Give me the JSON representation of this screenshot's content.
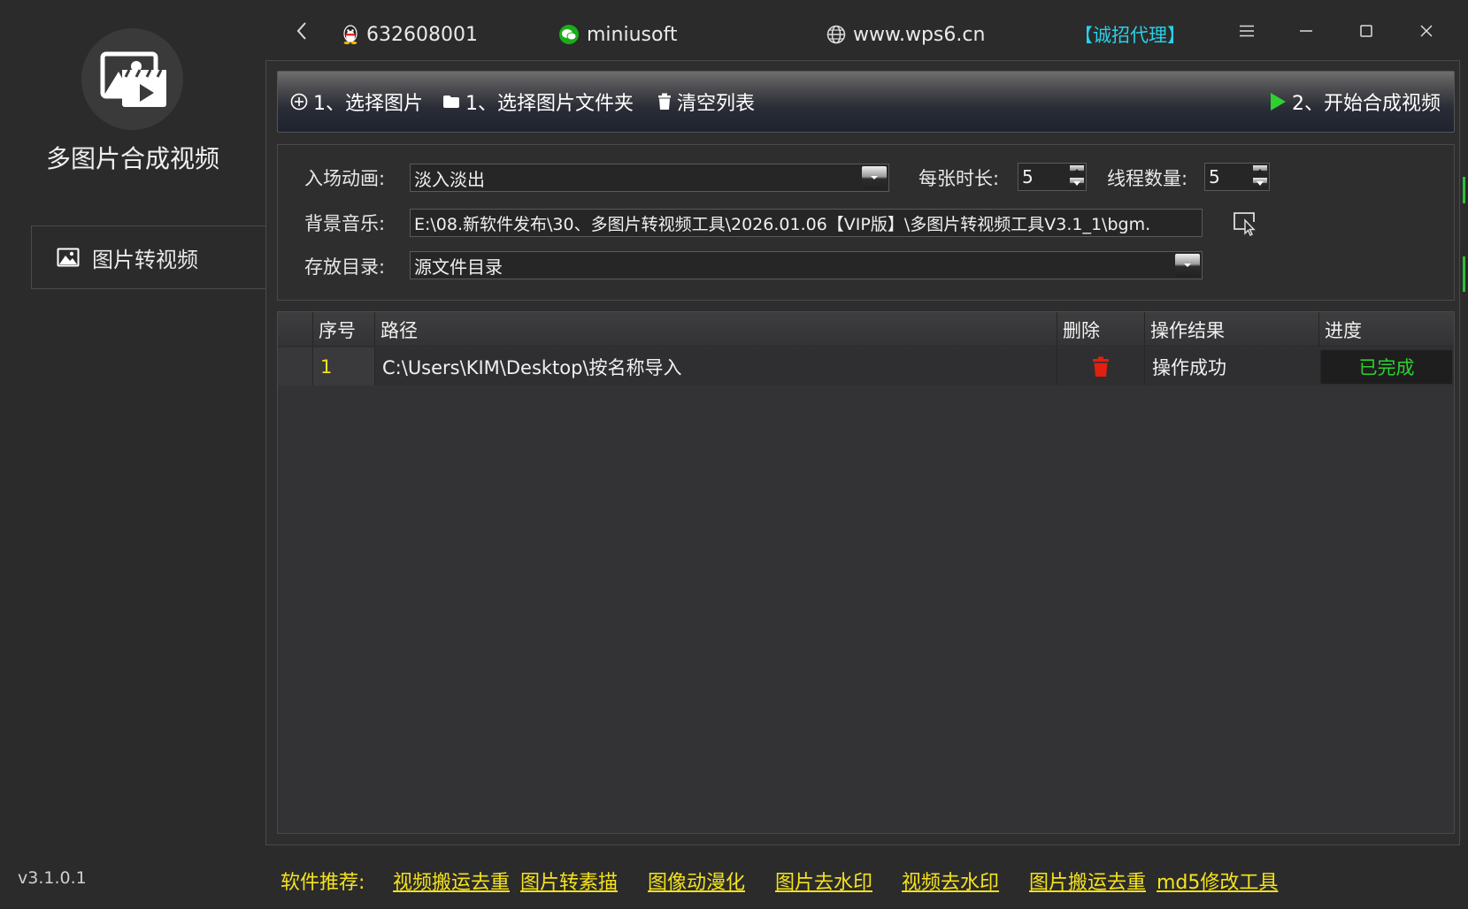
{
  "app": {
    "title": "多图片合成视频",
    "version": "v3.1.0.1"
  },
  "sidebar": {
    "items": [
      {
        "label": "图片转视频",
        "icon": "image-icon"
      }
    ]
  },
  "titlebar": {
    "qq": "632608001",
    "wechat": "miniusoft",
    "website": "www.wps6.cn",
    "agent": "【诚招代理】"
  },
  "toolbar": {
    "select_images": "1、选择图片",
    "select_folder": "1、选择图片文件夹",
    "clear_list": "清空列表",
    "start": "2、开始合成视频"
  },
  "settings": {
    "transition_label": "入场动画:",
    "transition_value": "淡入淡出",
    "duration_label": "每张时长:",
    "duration_value": "5",
    "threads_label": "线程数量:",
    "threads_value": "5",
    "bgm_label": "背景音乐:",
    "bgm_value": "E:\\08.新软件发布\\30、多图片转视频工具\\2026.01.06【VIP版】\\多图片转视频工具V3.1_1\\bgm.",
    "output_label": "存放目录:",
    "output_value": "源文件目录"
  },
  "table": {
    "columns": [
      "序号",
      "路径",
      "删除",
      "操作结果",
      "进度"
    ],
    "rows": [
      {
        "index": "1",
        "path": "C:\\Users\\KIM\\Desktop\\按名称导入",
        "result": "操作成功",
        "progress": "已完成"
      }
    ]
  },
  "footer": {
    "recommend_label": "软件推荐:",
    "links": [
      "视频搬运去重",
      "图片转素描",
      "图像动漫化",
      "图片去水印",
      "视频去水印",
      "图片搬运去重",
      "md5修改工具"
    ]
  },
  "colors": {
    "background": "#2b2b2b",
    "accent_cyan": "#2ad0e8",
    "accent_yellow": "#f5e31e",
    "success_green": "#2fd02f",
    "delete_red": "#e02010"
  }
}
